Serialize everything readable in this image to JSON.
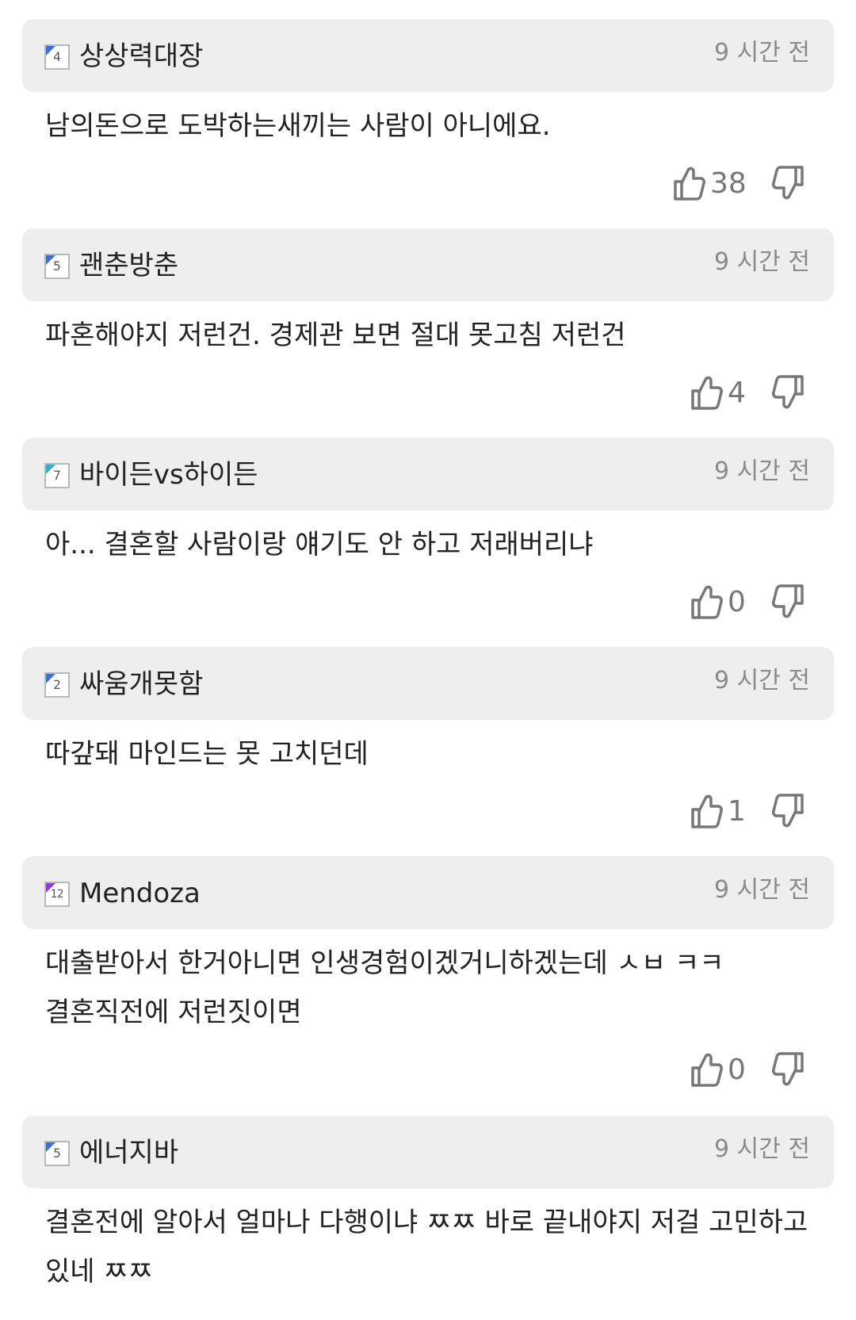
{
  "comments": [
    {
      "level": "4",
      "username": "상상력대장",
      "time": "9 시간 전",
      "text": "남의돈으로 도박하는새끼는 사람이 아니에요.",
      "likes": "38",
      "badge_color": "#3f6fd1"
    },
    {
      "level": "5",
      "username": "괜춘방춘",
      "time": "9 시간 전",
      "text": "파혼해야지 저런건. 경제관 보면 절대 못고침 저런건",
      "likes": "4",
      "badge_color": "#3f6fd1"
    },
    {
      "level": "7",
      "username": "바이든vs하이든",
      "time": "9 시간 전",
      "text": "아... 결혼할 사람이랑 얘기도 안 하고 저래버리냐",
      "likes": "0",
      "badge_color": "#3aa6d6"
    },
    {
      "level": "2",
      "username": "싸움개못함",
      "time": "9 시간 전",
      "text": "따갚돼 마인드는 못 고치던데",
      "likes": "1",
      "badge_color": "#3f6fd1"
    },
    {
      "level": "12",
      "username": "Mendoza",
      "time": "9 시간 전",
      "text": "대출받아서 한거아니면 인생경험이겠거니하겠는데 ㅅㅂ ㅋㅋ 결혼직전에 저런짓이면",
      "likes": "0",
      "badge_color": "#8a3fd6"
    },
    {
      "level": "5",
      "username": "에너지바",
      "time": "9 시간 전",
      "text": "결혼전에 알아서 얼마나 다행이냐 ㅉㅉ 바로 끝내야지 저걸 고민하고 있네 ㅉㅉ",
      "likes": "",
      "badge_color": "#3f6fd1"
    }
  ]
}
